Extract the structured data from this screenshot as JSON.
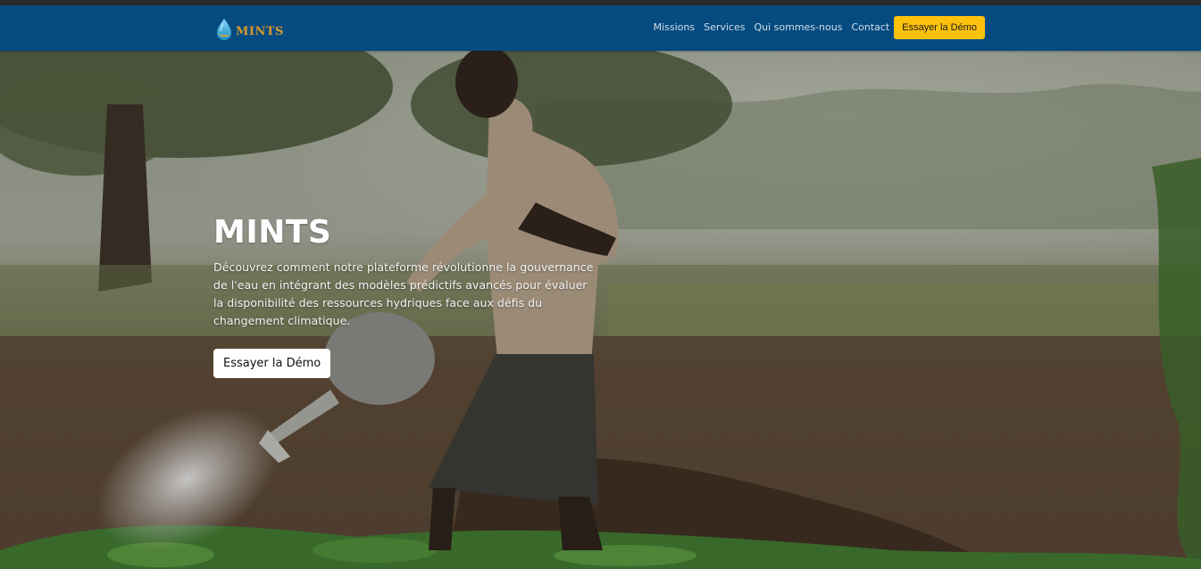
{
  "brand": {
    "name": "MINTS",
    "logo_icon": "water-drop-icon"
  },
  "nav": {
    "links": [
      "Missions",
      "Services",
      "Qui sommes-nous",
      "Contact"
    ],
    "cta_label": "Essayer la Démo"
  },
  "hero": {
    "title": "MINTS",
    "description": "Découvrez comment notre plateforme révolutionne la gouvernance de l'eau en intégrant des modèles prédictifs avancés pour évaluer la disponibilité des ressources hydriques face aux défis du changement climatique.",
    "button_label": "Essayer la Démo",
    "background_image": "farmer-watering-crops-photo"
  },
  "colors": {
    "navbar": "#054b80",
    "cta": "#fcc10d",
    "brand_text": "#d99a2b"
  }
}
